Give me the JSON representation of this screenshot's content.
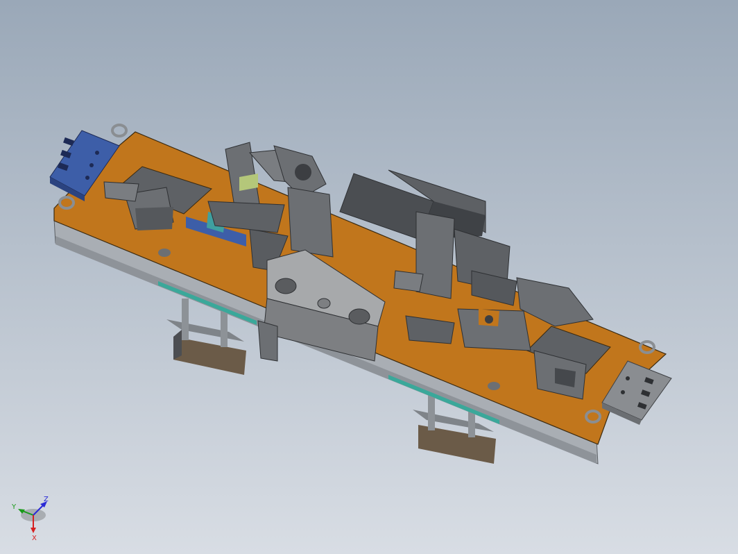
{
  "viewport": {
    "background_top": "#9aa8b8",
    "background_bottom": "#d8dde4"
  },
  "model": {
    "plate_color": "#c1761c",
    "frame_color": "#a9aeb4",
    "metal_color": "#6c6f73",
    "metal_dark": "#45484c",
    "block_blue": "#3d5ea8",
    "block_teal": "#3fa0a0",
    "cover_color": "#a7a9ab",
    "rail_green": "#3aa89a"
  },
  "triad": {
    "x_label": "X",
    "y_label": "Y",
    "z_label": "Z",
    "x_color": "#d62020",
    "y_color": "#1a9a1a",
    "z_color": "#2a2ad6"
  }
}
